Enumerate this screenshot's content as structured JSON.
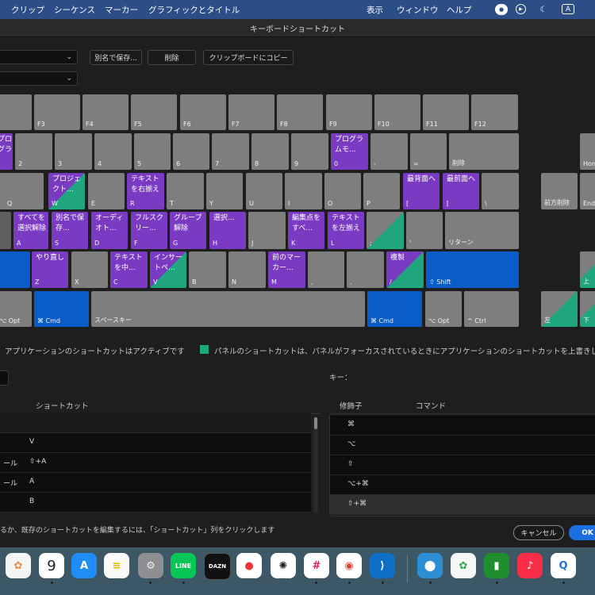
{
  "menubar": {
    "items": [
      "クリップ",
      "シーケンス",
      "マーカー",
      "グラフィックとタイトル"
    ],
    "right": [
      "表示",
      "ウィンドウ",
      "ヘルプ"
    ],
    "input_indicator": "A"
  },
  "window": {
    "title": "キーボードショートカット"
  },
  "toolbar": {
    "save_as": "別名で保存...",
    "delete": "削除",
    "copy_clipboard": "クリップボードにコピー"
  },
  "keyboard": {
    "row1": [
      "F3",
      "F4",
      "F5",
      "F6",
      "F7",
      "F8",
      "F9",
      "F10",
      "F11",
      "F12"
    ],
    "row2": [
      {
        "label": "",
        "cmd": "プロ\nグラ"
      },
      {
        "label": "2",
        "cmd": ""
      },
      {
        "label": "3",
        "cmd": ""
      },
      {
        "label": "4",
        "cmd": ""
      },
      {
        "label": "5",
        "cmd": ""
      },
      {
        "label": "6",
        "cmd": ""
      },
      {
        "label": "7",
        "cmd": ""
      },
      {
        "label": "8",
        "cmd": ""
      },
      {
        "label": "9",
        "cmd": ""
      },
      {
        "label": "0",
        "cmd": "プログラ\nムモ..."
      },
      {
        "label": "-",
        "cmd": ""
      },
      {
        "label": "=",
        "cmd": ""
      },
      {
        "label": "削除",
        "cmd": ""
      },
      {
        "label": "Home",
        "cmd": ""
      }
    ],
    "row3": [
      {
        "label": "Q",
        "cmd": ""
      },
      {
        "label": "W",
        "cmd": "プロジェ\nクト..."
      },
      {
        "label": "E",
        "cmd": ""
      },
      {
        "label": "R",
        "cmd": "テキスト\nを右揃え"
      },
      {
        "label": "T",
        "cmd": ""
      },
      {
        "label": "Y",
        "cmd": ""
      },
      {
        "label": "U",
        "cmd": ""
      },
      {
        "label": "I",
        "cmd": ""
      },
      {
        "label": "O",
        "cmd": ""
      },
      {
        "label": "P",
        "cmd": ""
      },
      {
        "label": "[",
        "cmd": "最背面へ"
      },
      {
        "label": "]",
        "cmd": "最前面へ"
      },
      {
        "label": "\\",
        "cmd": ""
      },
      {
        "label": "前方削除",
        "cmd": ""
      },
      {
        "label": "End",
        "cmd": ""
      }
    ],
    "row4": [
      {
        "label": "A",
        "cmd": "すべてを\n選択解除"
      },
      {
        "label": "S",
        "cmd": "別名で保\n存..."
      },
      {
        "label": "D",
        "cmd": "オーディ\nオト..."
      },
      {
        "label": "F",
        "cmd": "フルスク\nリー..."
      },
      {
        "label": "G",
        "cmd": "グループ\n解除"
      },
      {
        "label": "H",
        "cmd": "選択..."
      },
      {
        "label": "J",
        "cmd": ""
      },
      {
        "label": "K",
        "cmd": "編集点を\nすべ..."
      },
      {
        "label": "L",
        "cmd": "テキスト\nを左揃え"
      },
      {
        "label": ";",
        "cmd": ""
      },
      {
        "label": "'",
        "cmd": ""
      },
      {
        "label": "リターン",
        "cmd": ""
      }
    ],
    "row5": [
      {
        "label": "Z",
        "cmd": "やり直し"
      },
      {
        "label": "X",
        "cmd": ""
      },
      {
        "label": "C",
        "cmd": "テキスト\nを中..."
      },
      {
        "label": "V",
        "cmd": "インサー\nトペ..."
      },
      {
        "label": "B",
        "cmd": ""
      },
      {
        "label": "N",
        "cmd": ""
      },
      {
        "label": "M",
        "cmd": "前のマー\nカー..."
      },
      {
        "label": ",",
        "cmd": ""
      },
      {
        "label": ".",
        "cmd": ""
      },
      {
        "label": "/",
        "cmd": "複製"
      },
      {
        "label": "⇧ Shift",
        "cmd": ""
      },
      {
        "label": "上",
        "cmd": ""
      }
    ],
    "row6": [
      {
        "label": "⌥ Opt",
        "cmd": ""
      },
      {
        "label": "⌘ Cmd",
        "cmd": ""
      },
      {
        "label": "スペースキー",
        "cmd": ""
      },
      {
        "label": "⌘ Cmd",
        "cmd": ""
      },
      {
        "label": "⌥ Opt",
        "cmd": ""
      },
      {
        "label": "^ Ctrl",
        "cmd": ""
      },
      {
        "label": "左",
        "cmd": ""
      },
      {
        "label": "下",
        "cmd": ""
      }
    ]
  },
  "legend": {
    "app_active": "アプリケーションのショートカットはアクティブです",
    "panel_override": "パネルのショートカットは、パネルがフォーカスされているときにアプリケーションのショートカットを上書きします",
    "panel_color": "#1fa67e",
    "app_color": "#7a3bc2",
    "modifier_color": "#0a5dc8"
  },
  "key_field": {
    "label": "キー："
  },
  "left_table": {
    "header": "ショートカット",
    "rows": [
      {
        "command": "",
        "shortcut": "V"
      },
      {
        "command": "ール",
        "shortcut": "⇧+A"
      },
      {
        "command": "ール",
        "shortcut": "A"
      },
      {
        "command": "",
        "shortcut": "B"
      }
    ]
  },
  "right_table": {
    "headers": [
      "修飾子",
      "コマンド"
    ],
    "rows": [
      {
        "modifier": "⌘",
        "command": ""
      },
      {
        "modifier": "⌥",
        "command": ""
      },
      {
        "modifier": "⇧",
        "command": ""
      },
      {
        "modifier": "⌥+⌘",
        "command": ""
      },
      {
        "modifier": "⇧+⌘",
        "command": ""
      }
    ]
  },
  "footer": {
    "hint": "るか、既存のショートカットを編集するには、「ショートカット」列をクリックします",
    "cancel": "キャンセル",
    "ok": "OK"
  },
  "dock": {
    "calendar_day": "9"
  }
}
